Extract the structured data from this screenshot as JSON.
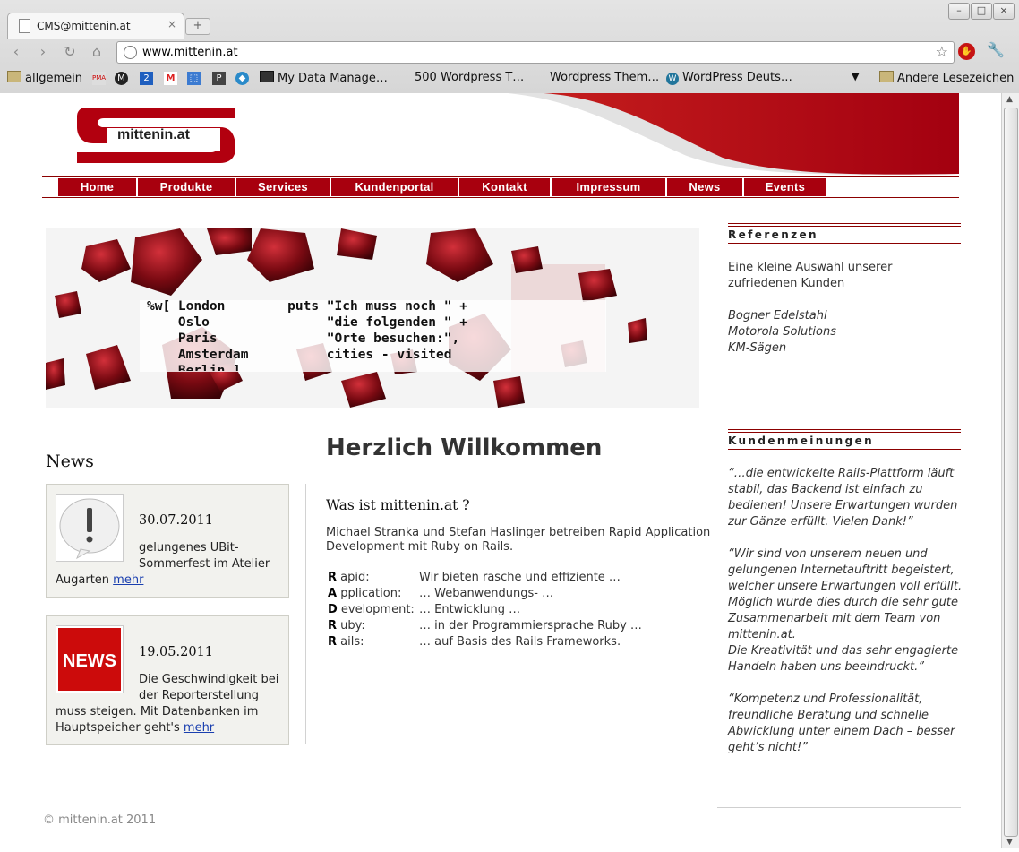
{
  "browser": {
    "tab_title": "CMS@mittenin.at",
    "tab_close": "×",
    "new_tab": "+",
    "url": "www.mittenin.at",
    "bookmarks": [
      {
        "label": "allgemein"
      },
      {
        "label": "My Data Manage…"
      },
      {
        "label": "500 Wordpress T…"
      },
      {
        "label": "Wordpress Them…"
      },
      {
        "label": "WordPress Deuts…"
      }
    ],
    "other_bookmarks": "Andere Lesezeichen"
  },
  "site": {
    "logo_text": "mittenin.at",
    "nav": [
      "Home",
      "Produkte",
      "Services",
      "Kundenportal",
      "Kontakt",
      "Impressum",
      "News",
      "Events"
    ],
    "banner_code": [
      "%w[ London        puts \"Ich muss noch \" +",
      "    Oslo               \"die folgenden \" +",
      "    Paris              \"Orte besuchen:\",",
      "    Amsterdam          cities - visited",
      "    Berlin ]"
    ],
    "news": {
      "heading": "News",
      "items": [
        {
          "date": "30.07.2011",
          "text_a": "gelungenes UBit-",
          "text_b": "Sommerfest im Atelier",
          "text_c": "Augarten",
          "more": "mehr",
          "thumb_label": "!"
        },
        {
          "date": "19.05.2011",
          "text_a": "Die Geschwindigkeit bei",
          "text_b": "der Reporterstellung",
          "text_c": "muss steigen. Mit Datenbanken im",
          "text_d": "Hauptspeicher geht's",
          "more": "mehr",
          "thumb_label": "NEWS"
        }
      ]
    },
    "main": {
      "title": "Herzlich Willkommen",
      "subtitle": "Was ist mittenin.at ?",
      "intro": "Michael Stranka und Stefan Haslinger betreiben Rapid Application Development mit Ruby on Rails.",
      "acronym": [
        {
          "letter": "R",
          "rest": " apid:",
          "desc": "Wir bieten rasche und effiziente …"
        },
        {
          "letter": "A",
          "rest": " pplication:",
          "desc": "… Webanwendungs- …"
        },
        {
          "letter": "D",
          "rest": " evelopment:",
          "desc": "… Entwicklung …"
        },
        {
          "letter": "R",
          "rest": " uby:",
          "desc": "… in der Programmiersprache Ruby …"
        },
        {
          "letter": "R",
          "rest": " ails:",
          "desc": "… auf Basis des Rails Frameworks."
        }
      ]
    },
    "sidebar": {
      "referenzen_heading": "Referenzen",
      "referenzen_intro": "Eine kleine Auswahl unserer zufriedenen Kunden",
      "clients": [
        "Bogner Edelstahl",
        "Motorola Solutions",
        "KM-Sägen"
      ],
      "meinungen_heading": "Kundenmeinungen",
      "quotes": [
        "“…die entwickelte Rails-Plattform läuft stabil, das Backend ist einfach zu bedienen! Unsere Erwartungen wurden zur Gänze erfüllt. Vielen Dank!”",
        "“Wir sind von unserem neuen und gelungenen Internetauftritt begeistert, welcher unsere Erwartungen voll erfüllt. Möglich wurde dies durch die sehr gute Zusammenarbeit mit dem Team von mittenin.at.",
        "Die Kreativität und das sehr engagierte Handeln haben uns beeindruckt.”",
        "“Kompetenz und Professionalität, freundliche Beratung und schnelle Abwicklung unter einem Dach – besser geht’s nicht!”"
      ]
    },
    "footer": "© mittenin.at 2011"
  },
  "colors": {
    "brand_red": "#a8000e",
    "dark_red": "#8b0000"
  }
}
